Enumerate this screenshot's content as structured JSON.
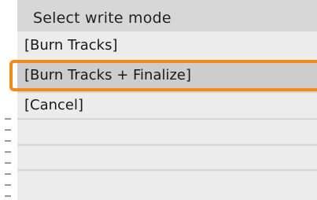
{
  "dialog": {
    "title": "Select write mode",
    "options": [
      {
        "label": "[Burn Tracks]",
        "selected": false
      },
      {
        "label": "[Burn Tracks + Finalize]",
        "selected": true
      },
      {
        "label": "[Cancel]",
        "selected": false
      }
    ]
  },
  "colors": {
    "highlight": "#f08a18",
    "panel_bg": "#ececec",
    "header_bg": "#d7d7d7"
  }
}
